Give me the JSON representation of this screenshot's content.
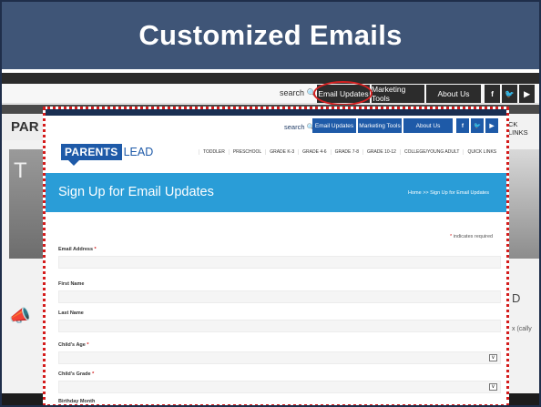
{
  "slide": {
    "title": "Customized Emails"
  },
  "background": {
    "search_label": "search",
    "nav_buttons": [
      "Email Updates",
      "Marketing Tools",
      "About Us"
    ],
    "social": [
      "f",
      "🐦",
      "▶"
    ],
    "brand_partial": "PAR",
    "quick_links": "CK LINKS",
    "hero_partial": "T",
    "right_partial": "D",
    "right_text": "x\n(cally"
  },
  "overlay": {
    "search_label": "search",
    "nav_buttons": [
      "Email Updates",
      "Marketing Tools",
      "About Us"
    ],
    "social": [
      "f",
      "🐦",
      "▶"
    ],
    "logo_box": "PARENTS",
    "logo_lead": "LEAD",
    "grades": [
      "TODDLER",
      "PRESCHOOL",
      "GRADE K-3",
      "GRADE 4-6",
      "GRADE 7-8",
      "GRADE 10-12",
      "COLLEGE/YOUNG ADULT",
      "QUICK LINKS"
    ],
    "banner_title": "Sign Up for Email Updates",
    "breadcrumb": "Home >> Sign Up for Email Updates",
    "required_note": "indicates required",
    "required_star": "*",
    "fields": [
      {
        "label": "Email Address",
        "required": true,
        "type": "text"
      },
      {
        "label": "First Name",
        "required": false,
        "type": "text"
      },
      {
        "label": "Last Name",
        "required": false,
        "type": "text"
      },
      {
        "label": "Child's Age",
        "required": true,
        "type": "select"
      },
      {
        "label": "Child's Grade",
        "required": true,
        "type": "select"
      },
      {
        "label": "Birthday Month",
        "required": false,
        "type": "select"
      }
    ]
  }
}
